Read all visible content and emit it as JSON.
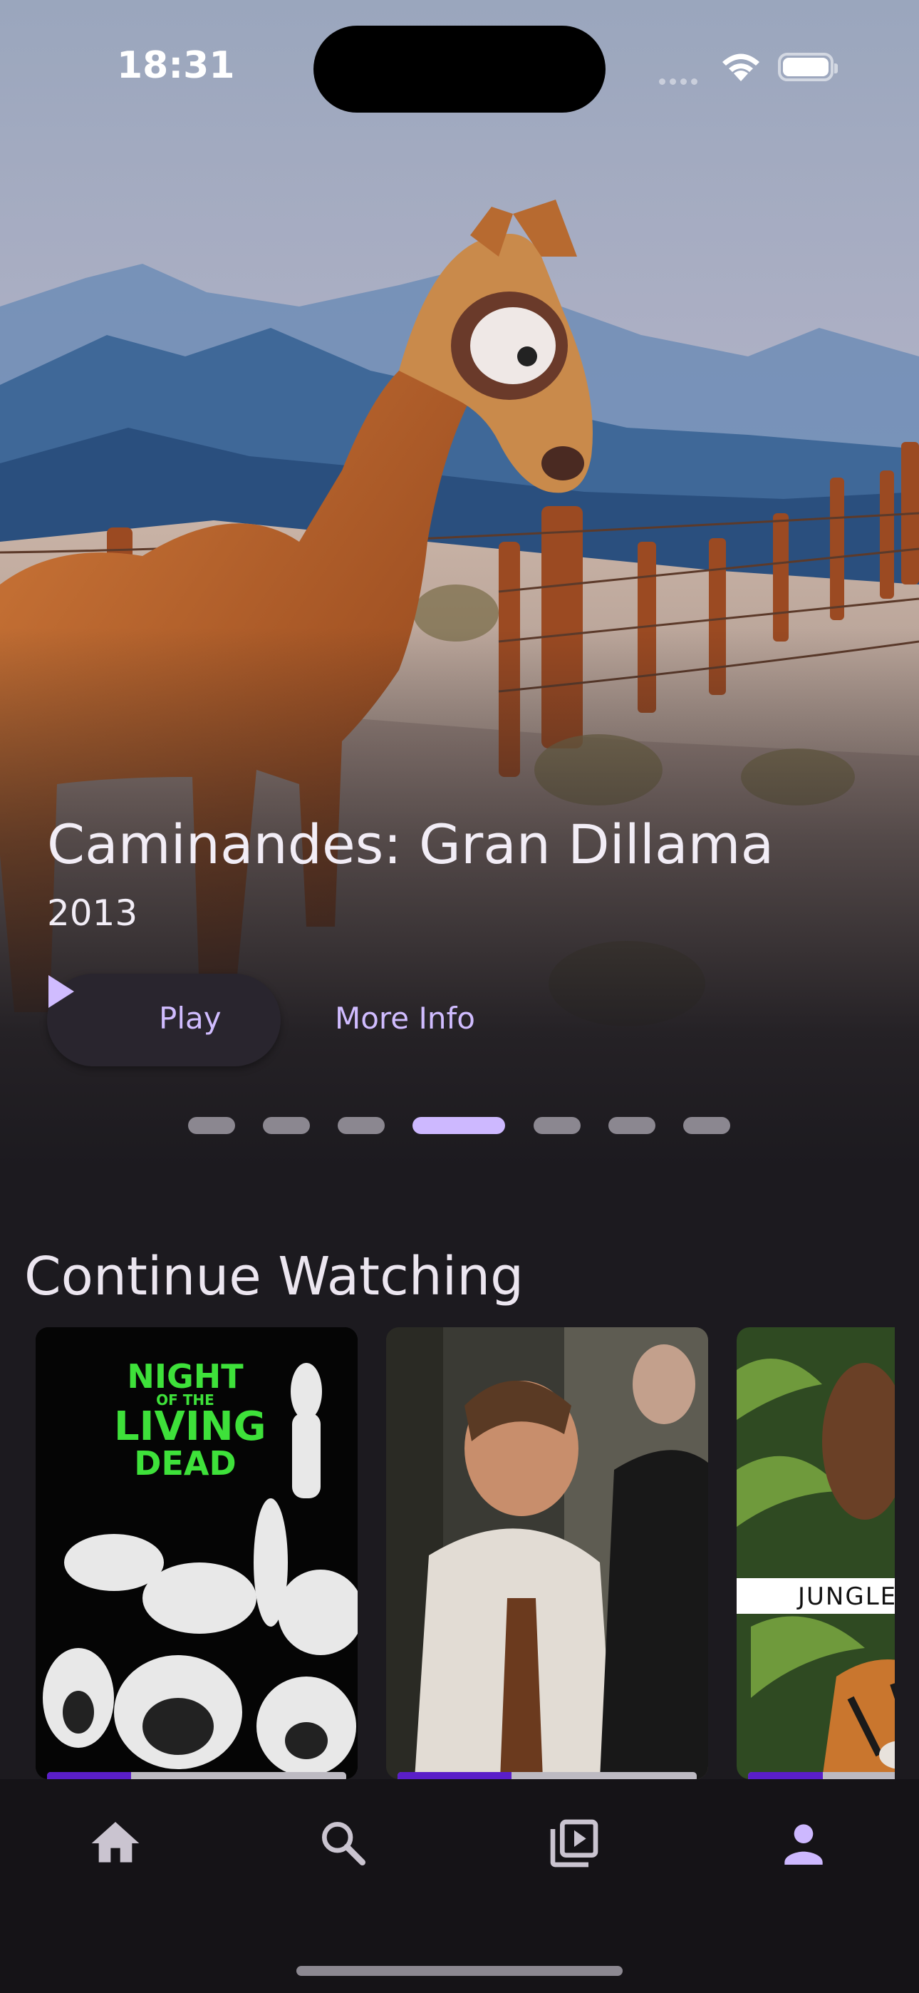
{
  "status_bar": {
    "time": "18:31"
  },
  "hero": {
    "title": "Caminandes: Gran Dillama",
    "year": "2013",
    "play_label": "Play",
    "more_info_label": "More Info",
    "carousel": {
      "count": 7,
      "active_index": 3
    }
  },
  "continue_watching": {
    "title": "Continue Watching",
    "items": [
      {
        "poster_text": [
          "NIGHT",
          "OF THE",
          "LIVING",
          "DEAD"
        ],
        "progress": 0.28
      },
      {
        "progress": 0.38
      },
      {
        "poster_text": [
          "JUNGLE"
        ],
        "progress": 0.25
      }
    ]
  },
  "bottom_nav": {
    "items": [
      {
        "icon": "home-icon"
      },
      {
        "icon": "search-icon"
      },
      {
        "icon": "video-library-icon"
      },
      {
        "icon": "person-icon",
        "active": true
      }
    ],
    "accent_color": "#cdb8ff"
  },
  "colors": {
    "accent": "#d0bcff",
    "background": "#1c1a1f",
    "progress_fill": "#5a1ec9"
  }
}
